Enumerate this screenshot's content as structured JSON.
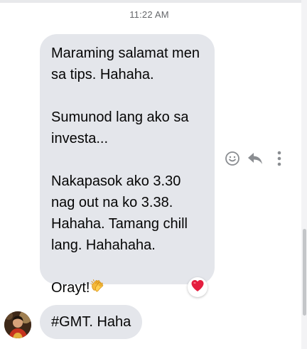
{
  "timestamp": "11:22 AM",
  "messages": [
    {
      "paragraphs": [
        "Maraming salamat men sa tips. Hahaha.",
        "Sumunod lang ako sa investa...",
        "Nakapasok ako 3.30 nag out na ko 3.38. Hahaha. Tamang chill lang. Hahahaha.",
        "Orayt!"
      ],
      "emoji": "clapping-hands",
      "reaction": "heart"
    },
    {
      "text": "#GMT. Haha"
    }
  ],
  "actions": [
    "react-icon",
    "reply-icon",
    "more-options-icon"
  ],
  "colors": {
    "bubble": "#e4e6eb",
    "text": "#050505",
    "timestamp": "#65676b",
    "icon": "#8a8d91",
    "heart": "#e41e3f"
  }
}
